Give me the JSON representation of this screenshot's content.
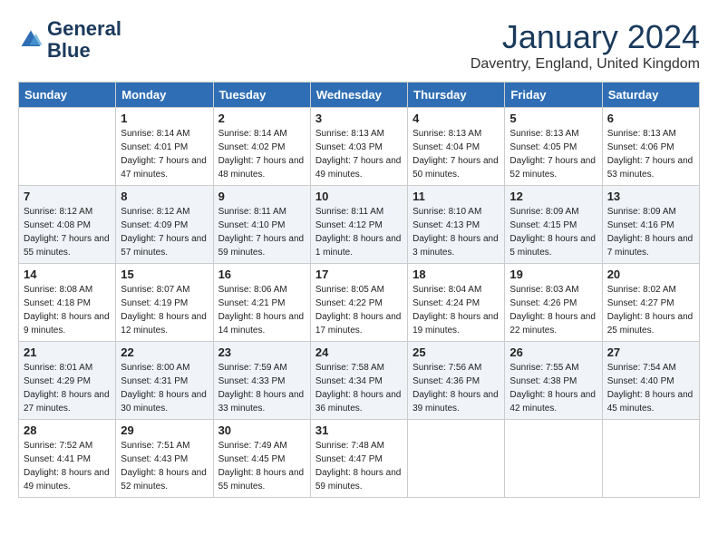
{
  "header": {
    "logo_line1": "General",
    "logo_line2": "Blue",
    "month_title": "January 2024",
    "subtitle": "Daventry, England, United Kingdom"
  },
  "days_of_week": [
    "Sunday",
    "Monday",
    "Tuesday",
    "Wednesday",
    "Thursday",
    "Friday",
    "Saturday"
  ],
  "weeks": [
    [
      {
        "num": "",
        "sunrise": "",
        "sunset": "",
        "daylight": ""
      },
      {
        "num": "1",
        "sunrise": "Sunrise: 8:14 AM",
        "sunset": "Sunset: 4:01 PM",
        "daylight": "Daylight: 7 hours and 47 minutes."
      },
      {
        "num": "2",
        "sunrise": "Sunrise: 8:14 AM",
        "sunset": "Sunset: 4:02 PM",
        "daylight": "Daylight: 7 hours and 48 minutes."
      },
      {
        "num": "3",
        "sunrise": "Sunrise: 8:13 AM",
        "sunset": "Sunset: 4:03 PM",
        "daylight": "Daylight: 7 hours and 49 minutes."
      },
      {
        "num": "4",
        "sunrise": "Sunrise: 8:13 AM",
        "sunset": "Sunset: 4:04 PM",
        "daylight": "Daylight: 7 hours and 50 minutes."
      },
      {
        "num": "5",
        "sunrise": "Sunrise: 8:13 AM",
        "sunset": "Sunset: 4:05 PM",
        "daylight": "Daylight: 7 hours and 52 minutes."
      },
      {
        "num": "6",
        "sunrise": "Sunrise: 8:13 AM",
        "sunset": "Sunset: 4:06 PM",
        "daylight": "Daylight: 7 hours and 53 minutes."
      }
    ],
    [
      {
        "num": "7",
        "sunrise": "Sunrise: 8:12 AM",
        "sunset": "Sunset: 4:08 PM",
        "daylight": "Daylight: 7 hours and 55 minutes."
      },
      {
        "num": "8",
        "sunrise": "Sunrise: 8:12 AM",
        "sunset": "Sunset: 4:09 PM",
        "daylight": "Daylight: 7 hours and 57 minutes."
      },
      {
        "num": "9",
        "sunrise": "Sunrise: 8:11 AM",
        "sunset": "Sunset: 4:10 PM",
        "daylight": "Daylight: 7 hours and 59 minutes."
      },
      {
        "num": "10",
        "sunrise": "Sunrise: 8:11 AM",
        "sunset": "Sunset: 4:12 PM",
        "daylight": "Daylight: 8 hours and 1 minute."
      },
      {
        "num": "11",
        "sunrise": "Sunrise: 8:10 AM",
        "sunset": "Sunset: 4:13 PM",
        "daylight": "Daylight: 8 hours and 3 minutes."
      },
      {
        "num": "12",
        "sunrise": "Sunrise: 8:09 AM",
        "sunset": "Sunset: 4:15 PM",
        "daylight": "Daylight: 8 hours and 5 minutes."
      },
      {
        "num": "13",
        "sunrise": "Sunrise: 8:09 AM",
        "sunset": "Sunset: 4:16 PM",
        "daylight": "Daylight: 8 hours and 7 minutes."
      }
    ],
    [
      {
        "num": "14",
        "sunrise": "Sunrise: 8:08 AM",
        "sunset": "Sunset: 4:18 PM",
        "daylight": "Daylight: 8 hours and 9 minutes."
      },
      {
        "num": "15",
        "sunrise": "Sunrise: 8:07 AM",
        "sunset": "Sunset: 4:19 PM",
        "daylight": "Daylight: 8 hours and 12 minutes."
      },
      {
        "num": "16",
        "sunrise": "Sunrise: 8:06 AM",
        "sunset": "Sunset: 4:21 PM",
        "daylight": "Daylight: 8 hours and 14 minutes."
      },
      {
        "num": "17",
        "sunrise": "Sunrise: 8:05 AM",
        "sunset": "Sunset: 4:22 PM",
        "daylight": "Daylight: 8 hours and 17 minutes."
      },
      {
        "num": "18",
        "sunrise": "Sunrise: 8:04 AM",
        "sunset": "Sunset: 4:24 PM",
        "daylight": "Daylight: 8 hours and 19 minutes."
      },
      {
        "num": "19",
        "sunrise": "Sunrise: 8:03 AM",
        "sunset": "Sunset: 4:26 PM",
        "daylight": "Daylight: 8 hours and 22 minutes."
      },
      {
        "num": "20",
        "sunrise": "Sunrise: 8:02 AM",
        "sunset": "Sunset: 4:27 PM",
        "daylight": "Daylight: 8 hours and 25 minutes."
      }
    ],
    [
      {
        "num": "21",
        "sunrise": "Sunrise: 8:01 AM",
        "sunset": "Sunset: 4:29 PM",
        "daylight": "Daylight: 8 hours and 27 minutes."
      },
      {
        "num": "22",
        "sunrise": "Sunrise: 8:00 AM",
        "sunset": "Sunset: 4:31 PM",
        "daylight": "Daylight: 8 hours and 30 minutes."
      },
      {
        "num": "23",
        "sunrise": "Sunrise: 7:59 AM",
        "sunset": "Sunset: 4:33 PM",
        "daylight": "Daylight: 8 hours and 33 minutes."
      },
      {
        "num": "24",
        "sunrise": "Sunrise: 7:58 AM",
        "sunset": "Sunset: 4:34 PM",
        "daylight": "Daylight: 8 hours and 36 minutes."
      },
      {
        "num": "25",
        "sunrise": "Sunrise: 7:56 AM",
        "sunset": "Sunset: 4:36 PM",
        "daylight": "Daylight: 8 hours and 39 minutes."
      },
      {
        "num": "26",
        "sunrise": "Sunrise: 7:55 AM",
        "sunset": "Sunset: 4:38 PM",
        "daylight": "Daylight: 8 hours and 42 minutes."
      },
      {
        "num": "27",
        "sunrise": "Sunrise: 7:54 AM",
        "sunset": "Sunset: 4:40 PM",
        "daylight": "Daylight: 8 hours and 45 minutes."
      }
    ],
    [
      {
        "num": "28",
        "sunrise": "Sunrise: 7:52 AM",
        "sunset": "Sunset: 4:41 PM",
        "daylight": "Daylight: 8 hours and 49 minutes."
      },
      {
        "num": "29",
        "sunrise": "Sunrise: 7:51 AM",
        "sunset": "Sunset: 4:43 PM",
        "daylight": "Daylight: 8 hours and 52 minutes."
      },
      {
        "num": "30",
        "sunrise": "Sunrise: 7:49 AM",
        "sunset": "Sunset: 4:45 PM",
        "daylight": "Daylight: 8 hours and 55 minutes."
      },
      {
        "num": "31",
        "sunrise": "Sunrise: 7:48 AM",
        "sunset": "Sunset: 4:47 PM",
        "daylight": "Daylight: 8 hours and 59 minutes."
      },
      {
        "num": "",
        "sunrise": "",
        "sunset": "",
        "daylight": ""
      },
      {
        "num": "",
        "sunrise": "",
        "sunset": "",
        "daylight": ""
      },
      {
        "num": "",
        "sunrise": "",
        "sunset": "",
        "daylight": ""
      }
    ]
  ]
}
